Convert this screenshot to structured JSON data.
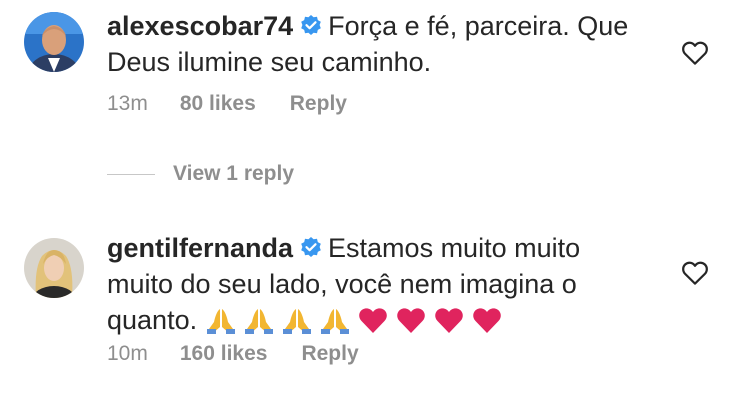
{
  "comments": [
    {
      "username": "alexescobar74",
      "text_line1": "Força e fé, parceira. Que",
      "text_line2": "Deus ilumine seu caminho.",
      "time": "13m",
      "likes": "80 likes",
      "reply": "Reply"
    },
    {
      "username": "gentilfernanda",
      "text_line1": "Estamos muito muito",
      "text_line2": "muito do seu lado, você nem imagina o",
      "text_line3": "quanto.",
      "emoji": [
        "praying-hands",
        "praying-hands",
        "praying-hands",
        "praying-hands",
        "red-heart",
        "red-heart",
        "red-heart",
        "red-heart"
      ],
      "time": "10m",
      "likes": "160 likes",
      "reply": "Reply"
    }
  ],
  "view_replies": "View 1 reply",
  "colors": {
    "text": "#262626",
    "meta": "#8e8e8e",
    "verified": "#3897f0",
    "heart": "#e0245e",
    "praying": "#f2b631"
  }
}
